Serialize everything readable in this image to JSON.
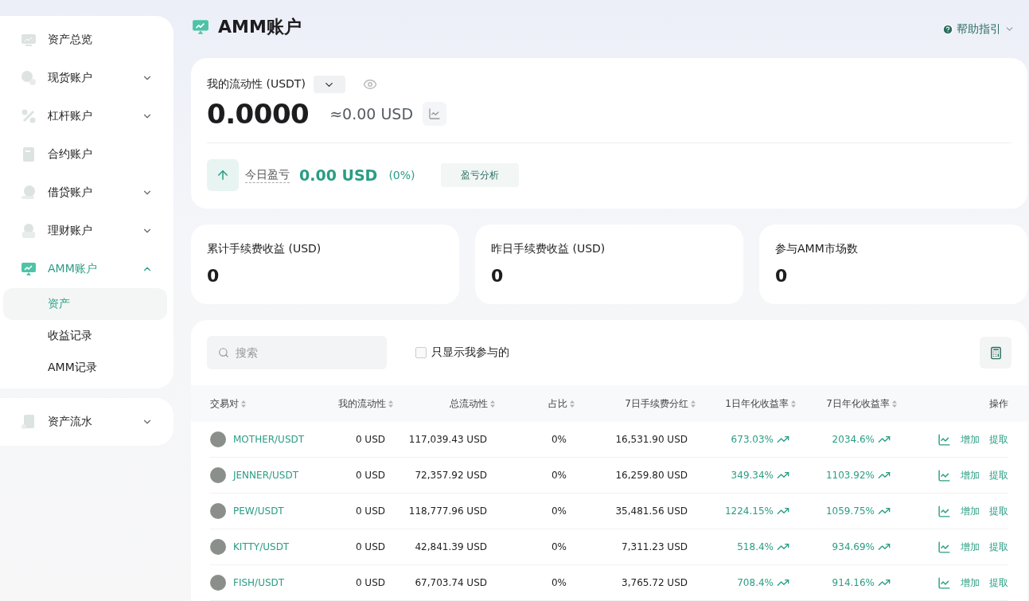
{
  "sidebar": {
    "groups": [
      {
        "items": [
          {
            "label": "资产总览",
            "kind": "link",
            "selected": false
          },
          {
            "label": "现货账户",
            "kind": "group",
            "selected": false,
            "expanded": false
          },
          {
            "label": "杠杆账户",
            "kind": "group",
            "selected": false,
            "expanded": false
          },
          {
            "label": "合约账户",
            "kind": "link",
            "selected": false
          },
          {
            "label": "借贷账户",
            "kind": "group",
            "selected": false,
            "expanded": false
          },
          {
            "label": "理财账户",
            "kind": "group",
            "selected": false,
            "expanded": false
          },
          {
            "label": "AMM账户",
            "kind": "group",
            "selected": true,
            "expanded": true,
            "children": [
              {
                "label": "资产",
                "selected": true
              },
              {
                "label": "收益记录",
                "selected": false
              },
              {
                "label": "AMM记录",
                "selected": false
              }
            ]
          }
        ]
      },
      {
        "items": [
          {
            "label": "资产流水",
            "kind": "group",
            "selected": false,
            "expanded": false
          }
        ]
      }
    ]
  },
  "page": {
    "title": "AMM账户",
    "help": "帮助指引"
  },
  "liquidity": {
    "label": "我的流动性 (USDT)",
    "value": "0.0000",
    "usd": "≈0.00 USD",
    "today_label": "今日盈亏",
    "today_value": "0.00 USD",
    "today_pct": "(0%)",
    "analysis_button": "盈亏分析"
  },
  "stats": [
    {
      "label": "累计手续费收益 (USD)",
      "value": "0"
    },
    {
      "label": "昨日手续费收益 (USD)",
      "value": "0"
    },
    {
      "label": "参与AMM市场数",
      "value": "0"
    }
  ],
  "filters": {
    "search_placeholder": "搜索",
    "only_mine": {
      "label": "只显示我参与的",
      "checked": false
    }
  },
  "table": {
    "columns": [
      {
        "label": "交易对",
        "sortable": true
      },
      {
        "label": "我的流动性",
        "sortable": true
      },
      {
        "label": "总流动性",
        "sortable": true
      },
      {
        "label": "占比",
        "sortable": true
      },
      {
        "label": "7日手续费分红",
        "sortable": true
      },
      {
        "label": "1日年化收益率",
        "sortable": true
      },
      {
        "label": "7日年化收益率",
        "sortable": true
      },
      {
        "label": "操作",
        "sortable": false
      }
    ],
    "rows": [
      {
        "pair": "MOTHER/USDT",
        "mine": "0 USD",
        "total": "117,039.43 USD",
        "share": "0%",
        "fee7": "16,531.90 USD",
        "apy1": "673.03%",
        "apy7": "2034.6%",
        "add": "增加",
        "withdraw": "提取"
      },
      {
        "pair": "JENNER/USDT",
        "mine": "0 USD",
        "total": "72,357.92 USD",
        "share": "0%",
        "fee7": "16,259.80 USD",
        "apy1": "349.34%",
        "apy7": "1103.92%",
        "add": "增加",
        "withdraw": "提取"
      },
      {
        "pair": "PEW/USDT",
        "mine": "0 USD",
        "total": "118,777.96 USD",
        "share": "0%",
        "fee7": "35,481.56 USD",
        "apy1": "1224.15%",
        "apy7": "1059.75%",
        "add": "增加",
        "withdraw": "提取"
      },
      {
        "pair": "KITTY/USDT",
        "mine": "0 USD",
        "total": "42,841.39 USD",
        "share": "0%",
        "fee7": "7,311.23 USD",
        "apy1": "518.4%",
        "apy7": "934.69%",
        "add": "增加",
        "withdraw": "提取"
      },
      {
        "pair": "FISH/USDT",
        "mine": "0 USD",
        "total": "67,703.74 USD",
        "share": "0%",
        "fee7": "3,765.72 USD",
        "apy1": "708.4%",
        "apy7": "914.16%",
        "add": "增加",
        "withdraw": "提取"
      }
    ]
  }
}
